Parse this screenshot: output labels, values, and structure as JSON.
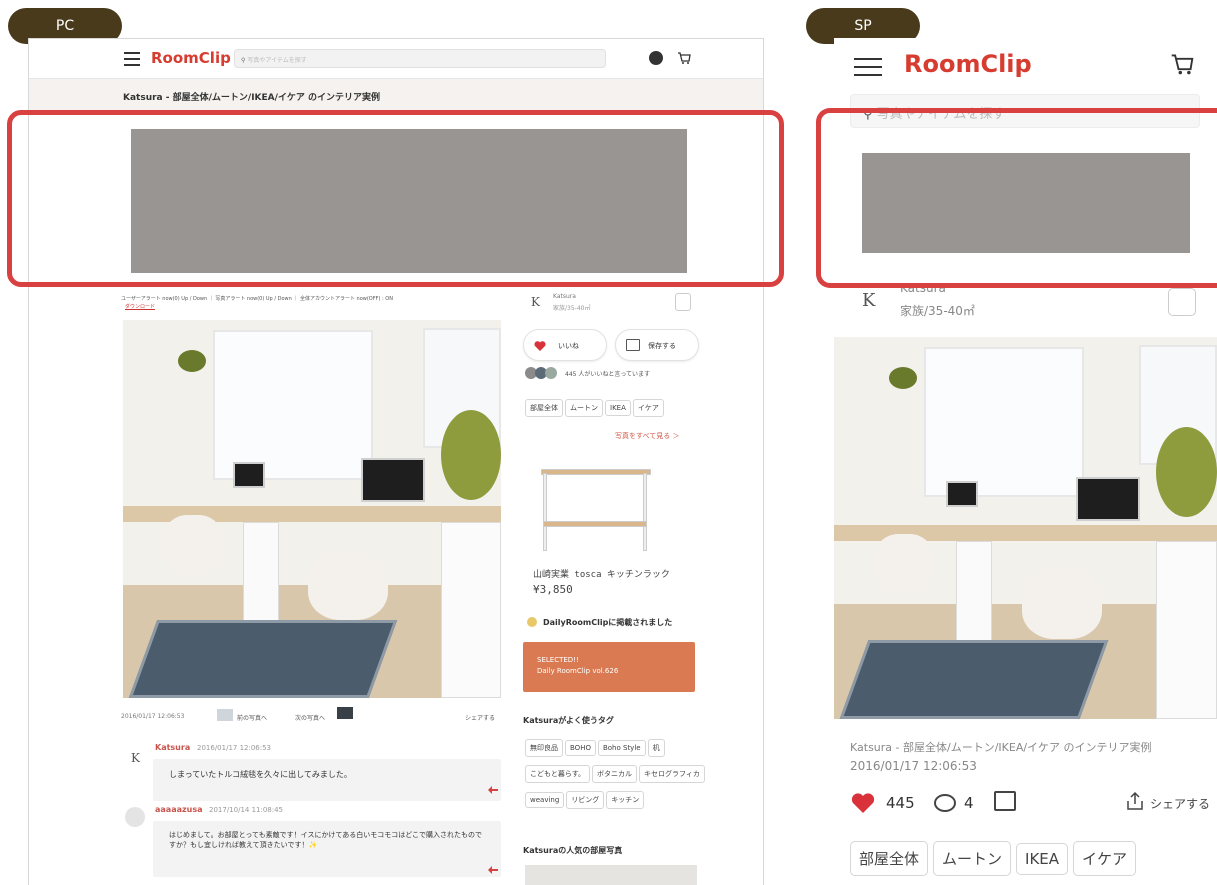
{
  "labels": {
    "pc": "PC",
    "sp": "SP"
  },
  "pc": {
    "logo": "RoomClip",
    "search_placeholder": "写真やアイテムを探す",
    "page_title": "Katsura - 部屋全体/ムートン/IKEA/イケア のインテリア実例",
    "alert_line1": "ユーザーアラート now(0) Up / Down  ｜ 写真アラート now(0) Up / Down  ｜ 全体アカウントアラート now(OFF) : ON",
    "alert_line2": "ダウンロード",
    "user": {
      "initial": "K",
      "name": "Katsura",
      "meta": "家族/35-40㎡"
    },
    "like_label": "いいね",
    "save_label": "保存する",
    "likes_text": "445 人がいいねと言っています",
    "tags": [
      "部屋全体",
      "ムートン",
      "IKEA",
      "イケア"
    ],
    "see_all": "写真をすべて見る ＞",
    "product_name": "山崎実業 tosca キッチンラック",
    "product_price": "¥3,850",
    "daily_text": "DailyRoomClipに掲載されました",
    "selected_line1": "SELECTED!!",
    "selected_line2": "Daily RoomClip vol.626",
    "date": "2016/01/17 12:06:53",
    "prev_label": "前の写真へ",
    "next_label": "次の写真へ",
    "share_label": "シェアする",
    "tags_title": "Katsuraがよく使うタグ",
    "fav_tags": [
      "無印良品",
      "BOHO",
      "Boho Style",
      "机",
      "こどもと暮らす。",
      "ボタニカル",
      "キセログラフィカ",
      "weaving",
      "リビング",
      "キッチン"
    ],
    "popular_title": "Katsuraの人気の部屋写真",
    "comments": [
      {
        "author": "Katsura",
        "date": "2016/01/17 12:06:53",
        "text": "しまっていたトルコ絨毯を久々に出してみました。"
      },
      {
        "author": "aaaaazusa",
        "date": "2017/10/14 11:08:45",
        "text": "はじめまして。お部屋とっても素敵です！イスにかけてある白いモコモコはどこで購入されたものですか？もし宜しければ教えて頂きたいです！✨"
      }
    ]
  },
  "sp": {
    "logo": "RoomClip",
    "search_placeholder": "写真やアイテムを探す",
    "user": {
      "initial": "K",
      "name": "Katsura",
      "meta": "家族/35-40㎡"
    },
    "caption": "Katsura - 部屋全体/ムートン/IKEA/イケア のインテリア実例",
    "date": "2016/01/17 12:06:53",
    "likes": "445",
    "comments": "4",
    "share_label": "シェアする",
    "tags": [
      "部屋全体",
      "ムートン",
      "IKEA",
      "イケア"
    ]
  },
  "colors": {
    "accent": "#d94040",
    "brand": "#d63c2f",
    "pill": "#4a3a1c",
    "selected": "#d97a52",
    "ad": "#989592"
  }
}
